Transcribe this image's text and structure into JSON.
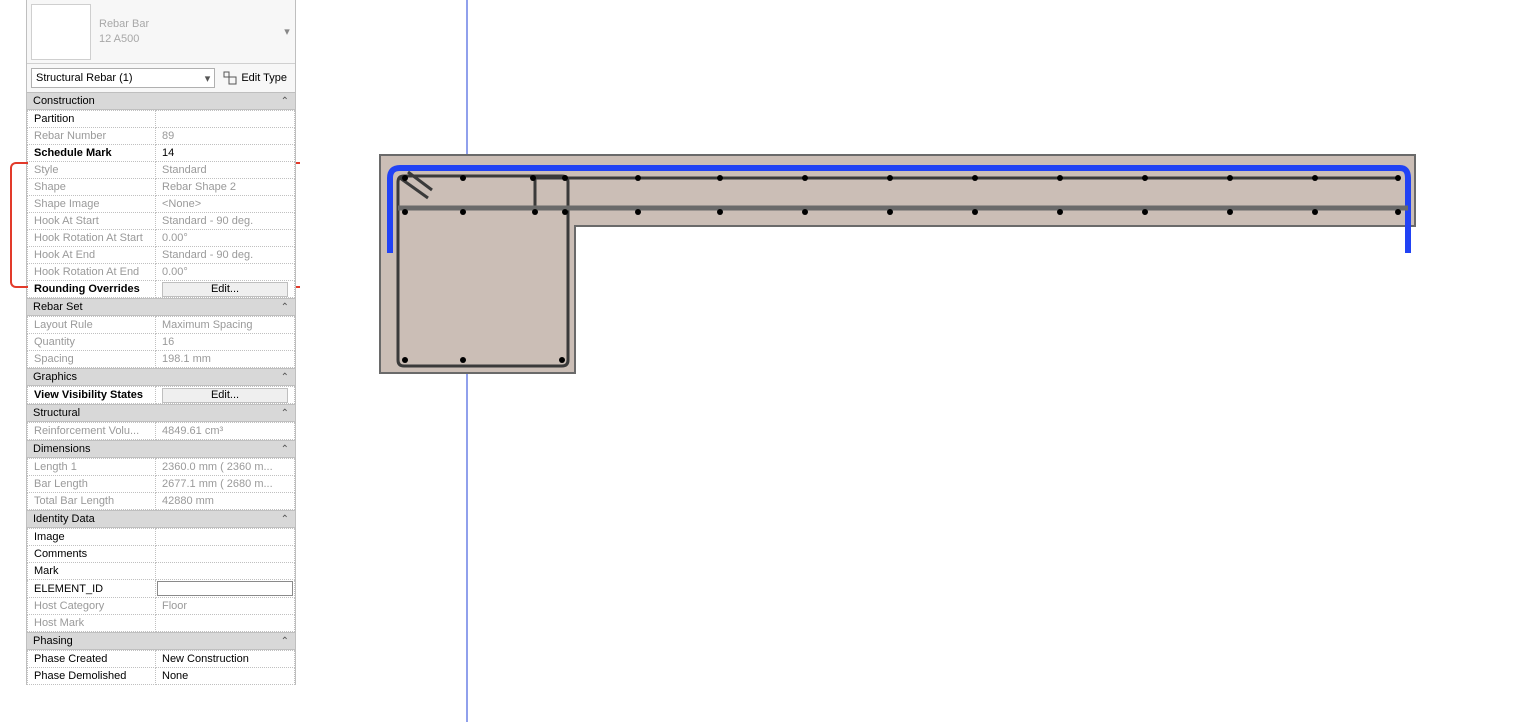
{
  "type_selector": {
    "title": "Rebar Bar",
    "subtitle": "12 A500"
  },
  "filter": {
    "selected": "Structural Rebar (1)"
  },
  "edit_type_label": "Edit Type",
  "sections": {
    "construction": "Construction",
    "rebar_set": "Rebar Set",
    "graphics": "Graphics",
    "structural": "Structural",
    "dimensions": "Dimensions",
    "identity": "Identity Data",
    "phasing": "Phasing"
  },
  "props": {
    "partition": {
      "label": "Partition",
      "value": ""
    },
    "rebar_number": {
      "label": "Rebar Number",
      "value": "89"
    },
    "schedule_mark": {
      "label": "Schedule Mark",
      "value": "14"
    },
    "style": {
      "label": "Style",
      "value": "Standard"
    },
    "shape": {
      "label": "Shape",
      "value": "Rebar Shape 2"
    },
    "shape_image": {
      "label": "Shape Image",
      "value": "<None>"
    },
    "hook_start": {
      "label": "Hook At Start",
      "value": "Standard - 90 deg."
    },
    "hook_rot_start": {
      "label": "Hook Rotation At Start",
      "value": "0.00°"
    },
    "hook_end": {
      "label": "Hook At End",
      "value": "Standard - 90 deg."
    },
    "hook_rot_end": {
      "label": "Hook Rotation At End",
      "value": "0.00°"
    },
    "rounding": {
      "label": "Rounding Overrides",
      "button": "Edit..."
    },
    "layout_rule": {
      "label": "Layout Rule",
      "value": "Maximum Spacing"
    },
    "quantity": {
      "label": "Quantity",
      "value": "16"
    },
    "spacing": {
      "label": "Spacing",
      "value": "198.1 mm"
    },
    "visibility": {
      "label": "View Visibility States",
      "button": "Edit..."
    },
    "reinf_vol": {
      "label": "Reinforcement Volu...",
      "value": "4849.61 cm³"
    },
    "length1": {
      "label": "Length 1",
      "value": "2360.0 mm ( 2360 m..."
    },
    "bar_length": {
      "label": "Bar Length",
      "value": "2677.1 mm ( 2680 m..."
    },
    "total_bar_length": {
      "label": "Total Bar Length",
      "value": "42880 mm"
    },
    "image": {
      "label": "Image",
      "value": ""
    },
    "comments": {
      "label": "Comments",
      "value": ""
    },
    "mark": {
      "label": "Mark",
      "value": ""
    },
    "element_id": {
      "label": "ELEMENT_ID",
      "value": ""
    },
    "host_cat": {
      "label": "Host Category",
      "value": "Floor"
    },
    "host_mark": {
      "label": "Host Mark",
      "value": ""
    },
    "phase_created": {
      "label": "Phase Created",
      "value": "New Construction"
    },
    "phase_demolished": {
      "label": "Phase Demolished",
      "value": "None"
    }
  },
  "drawing": {
    "guide_color": "#2142d8",
    "rebar_highlight_color": "#2142f4",
    "concrete_fill": "#cbbeb6",
    "concrete_stroke": "#6a6a6a"
  }
}
